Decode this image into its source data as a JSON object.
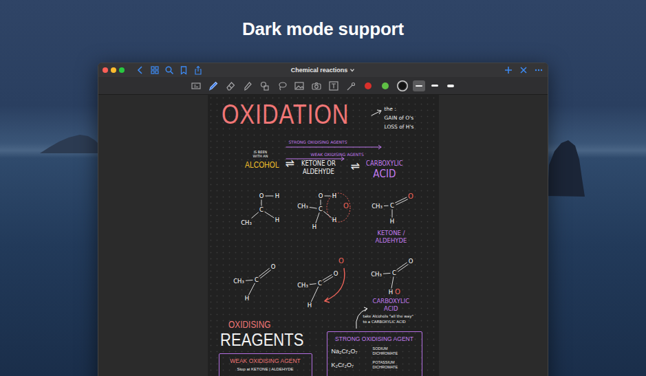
{
  "headline": "Dark mode support",
  "window": {
    "title": "Chemical reactions"
  },
  "toolbar": {
    "tools": [
      {
        "kind": "template",
        "selected": false
      },
      {
        "kind": "pen",
        "selected": true
      },
      {
        "kind": "eraser",
        "selected": false
      },
      {
        "kind": "highlighter",
        "selected": false
      },
      {
        "kind": "shapes",
        "selected": false
      },
      {
        "kind": "lasso",
        "selected": false
      },
      {
        "kind": "image",
        "selected": false
      },
      {
        "kind": "camera",
        "selected": false
      },
      {
        "kind": "text",
        "selected": false
      },
      {
        "kind": "laser",
        "selected": false
      }
    ],
    "colors": [
      {
        "color": "#d9302b",
        "selected": false
      },
      {
        "color": "#5fbf45",
        "selected": false
      },
      {
        "color": "#111111",
        "selected": true
      }
    ],
    "widths": [
      {
        "level": 0.3,
        "selected": true
      },
      {
        "level": 0.55,
        "selected": false
      },
      {
        "level": 0.85,
        "selected": false
      }
    ]
  },
  "page": {
    "title": "OXIDATION",
    "definition": [
      "the :",
      "GAIN of O's",
      "LOSS of H's"
    ],
    "strong_agents": "STRONG OXIDISING AGENTS",
    "weak_agents": "WEAK OXIDISING AGENTS",
    "alcohol_note": [
      "IS BEEN",
      "WITH AN"
    ],
    "alcohol": "ALCOHOL",
    "equilibrium": [
      "⇌",
      "⇌"
    ],
    "ketone": [
      "KETONE OR",
      "ALDEHYDE"
    ],
    "acid": [
      "CARBOXYLIC",
      "ACID"
    ],
    "molecules": [
      {
        "atoms": [
          {
            "text": "O",
            "color": "#ffffff"
          },
          {
            "text": "H",
            "color": "#ffffff"
          },
          {
            "text": "C",
            "color": "#ffffff"
          },
          {
            "text": "CH₃",
            "color": "#ffffff"
          },
          {
            "text": "H",
            "color": "#ffffff"
          }
        ]
      },
      {
        "atoms": [
          {
            "text": "O",
            "color": "#ffffff"
          },
          {
            "text": "H",
            "color": "#ffffff"
          },
          {
            "text": "C",
            "color": "#ffffff"
          },
          {
            "text": "CH₃",
            "color": "#ffffff"
          },
          {
            "text": "H",
            "color": "#ffffff"
          },
          {
            "text": "H",
            "color": "#ffffff"
          },
          {
            "text": "O",
            "color": "#f0645a"
          }
        ]
      },
      {
        "atoms": [
          {
            "text": "CH₃",
            "color": "#ffffff"
          },
          {
            "text": "C",
            "color": "#ffffff"
          },
          {
            "text": "O",
            "color": "#f0645a"
          },
          {
            "text": "H",
            "color": "#ffffff"
          }
        ]
      },
      {
        "atoms": [
          {
            "text": "CH₃",
            "color": "#ffffff"
          },
          {
            "text": "C",
            "color": "#ffffff"
          },
          {
            "text": "O",
            "color": "#ffffff"
          },
          {
            "text": "H",
            "color": "#ffffff"
          }
        ]
      },
      {
        "atoms": [
          {
            "text": "CH₃",
            "color": "#ffffff"
          },
          {
            "text": "C",
            "color": "#ffffff"
          },
          {
            "text": "O",
            "color": "#ffffff"
          },
          {
            "text": "H",
            "color": "#ffffff"
          },
          {
            "text": "O",
            "color": "#f0645a"
          }
        ]
      },
      {
        "atoms": [
          {
            "text": "CH₃",
            "color": "#ffffff"
          },
          {
            "text": "C",
            "color": "#ffffff"
          },
          {
            "text": "O",
            "color": "#ffffff"
          },
          {
            "text": "H",
            "color": "#ffffff"
          },
          {
            "text": "O",
            "color": "#f0645a"
          }
        ]
      }
    ],
    "ketone_label": [
      "KETONE /",
      "ALDEHYDE"
    ],
    "acid_label": [
      "CARBOXYLIC",
      "ACID"
    ],
    "acid_note": [
      "take Alcohols \"all the way\"",
      "to a CARBOXYLIC ACID"
    ],
    "reagents": [
      "OXIDISING",
      "REAGENTS"
    ],
    "weak_box": {
      "title": "WEAK OXIDISING AGENT",
      "note": "Stop at KETONE | ALDEHYDE"
    },
    "strong_box": {
      "title": "STRONG OXIDISING AGENT",
      "rows": [
        {
          "formula": "Na₂Cr₂O₇",
          "name": [
            "SODIUM",
            "DICHROMATE"
          ]
        },
        {
          "formula": "K₂Cr₂O₇",
          "name": [
            "POTASSIUM",
            "DICHROMATE"
          ]
        }
      ]
    }
  }
}
